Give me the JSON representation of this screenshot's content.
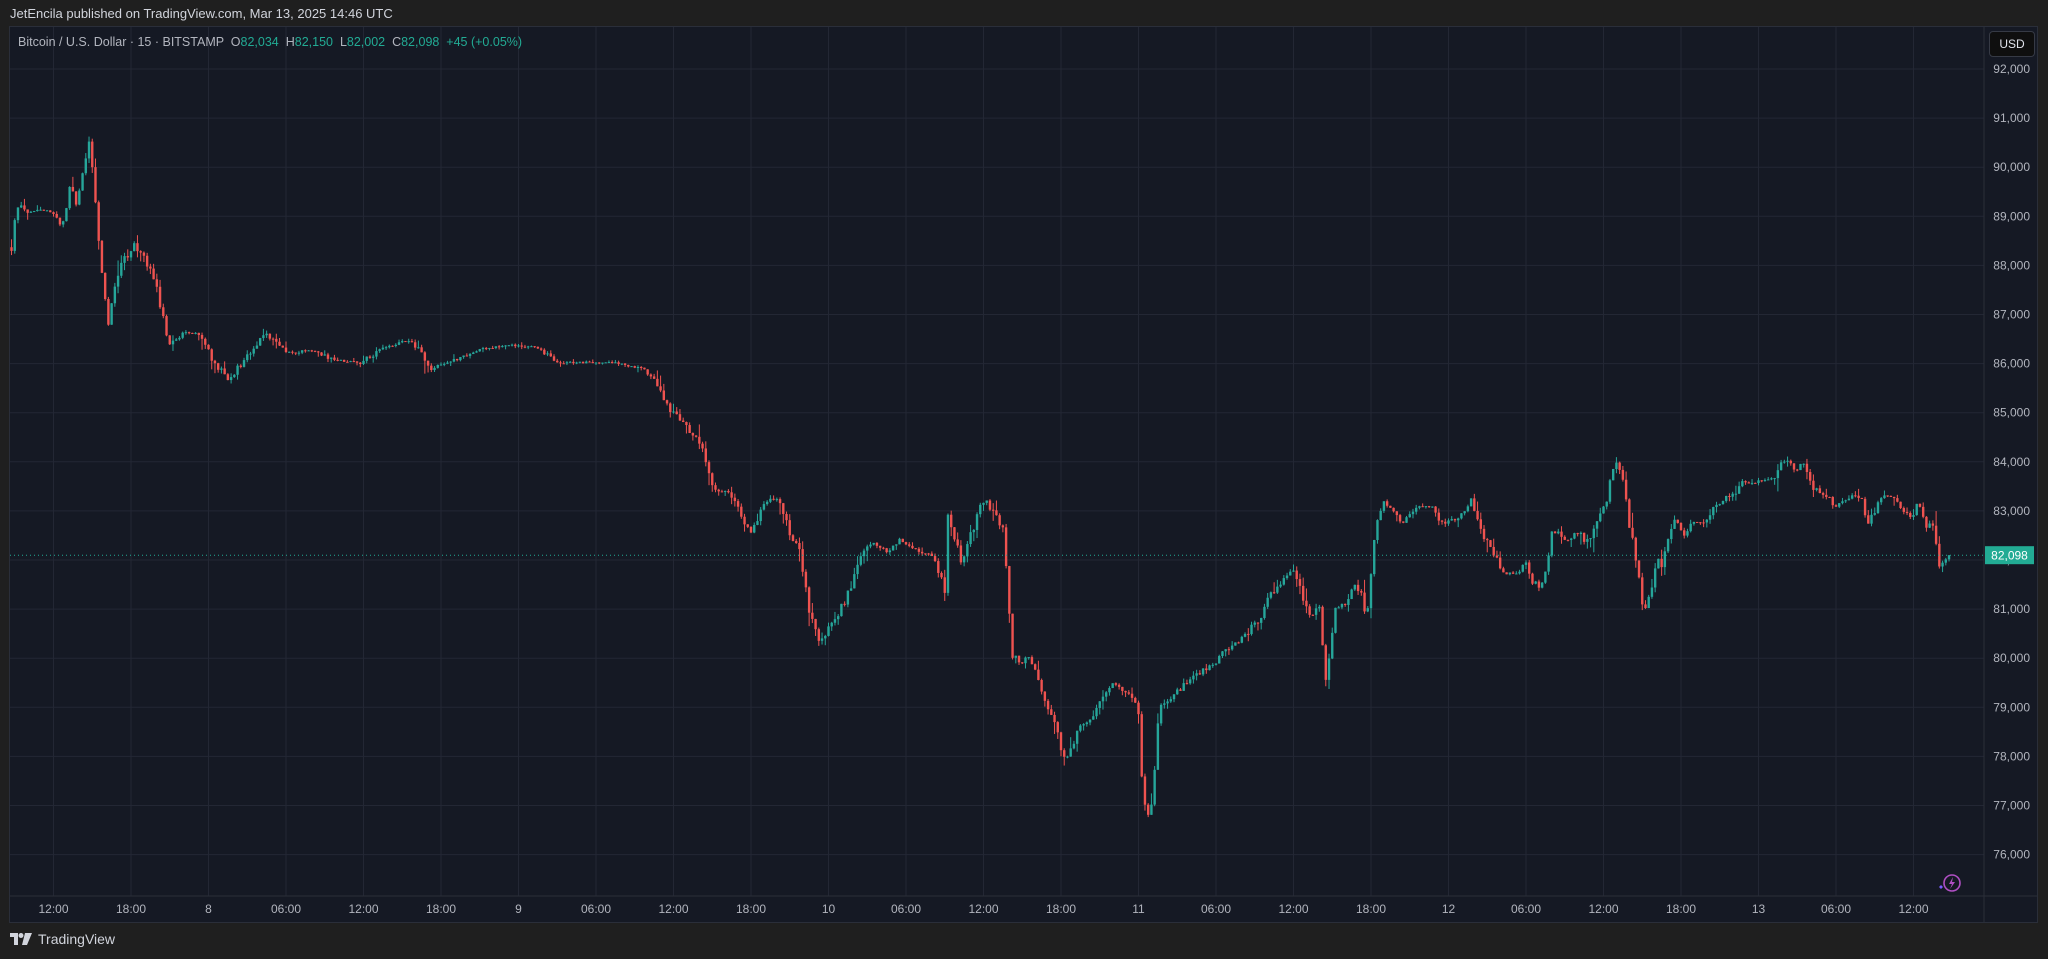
{
  "header": {
    "published": "JetEncila published on TradingView.com, Mar 13, 2025 14:46 UTC"
  },
  "legend": {
    "symbol": "Bitcoin / U.S. Dollar · 15 · BITSTAMP",
    "open_label": "O",
    "open": "82,034",
    "high_label": "H",
    "high": "82,150",
    "low_label": "L",
    "low": "82,002",
    "close_label": "C",
    "close": "82,098",
    "change": "+45 (+0.05%)"
  },
  "currency_button": "USD",
  "footer": {
    "brand": "TradingView"
  },
  "colors": {
    "up": "#26a69a",
    "down": "#ef5350",
    "background": "#151924",
    "grid": "#232734",
    "last_price": "#22ab94"
  },
  "icons": {
    "footer_logo": "tradingview-logo-icon",
    "assistant": "lightning-icon"
  },
  "chart_data": {
    "type": "candlestick",
    "title": "Bitcoin / U.S. Dollar · 15 · BITSTAMP",
    "interval_minutes": 15,
    "x_unit": "hours since Mar 7 12:00",
    "x_range": [
      -3.25,
      146.75
    ],
    "ylim": [
      75300,
      92800
    ],
    "y_ticks": [
      76000,
      77000,
      78000,
      79000,
      80000,
      81000,
      82000,
      83000,
      84000,
      85000,
      86000,
      87000,
      88000,
      89000,
      90000,
      91000,
      92000
    ],
    "y_tick_labels": [
      "76,000",
      "77,000",
      "78,000",
      "79,000",
      "80,000",
      "81,000",
      "82,000",
      "83,000",
      "84,000",
      "85,000",
      "86,000",
      "87,000",
      "88,000",
      "89,000",
      "90,000",
      "91,000",
      "92,000"
    ],
    "x_ticks": [
      0,
      6,
      12,
      18,
      24,
      30,
      36,
      42,
      48,
      54,
      60,
      66,
      72,
      78,
      84,
      90,
      96,
      102,
      108,
      114,
      120,
      126,
      132,
      138,
      144
    ],
    "x_tick_labels": [
      "12:00",
      "18:00",
      "8",
      "06:00",
      "12:00",
      "18:00",
      "9",
      "06:00",
      "12:00",
      "18:00",
      "10",
      "06:00",
      "12:00",
      "18:00",
      "11",
      "06:00",
      "12:00",
      "18:00",
      "12",
      "06:00",
      "12:00",
      "18:00",
      "13",
      "06:00",
      "12:00"
    ],
    "last_price": 82098,
    "last_price_label": "82,098",
    "grid": true,
    "price_path": [
      [
        -3.3,
        88270
      ],
      [
        -2.8,
        89270
      ],
      [
        -1.8,
        89070
      ],
      [
        -1,
        89130
      ],
      [
        0.1,
        89070
      ],
      [
        0.66,
        88660
      ],
      [
        1.3,
        89740
      ],
      [
        1.8,
        89190
      ],
      [
        2.4,
        90100
      ],
      [
        2.7,
        90600
      ],
      [
        3.2,
        89470
      ],
      [
        3.6,
        88250
      ],
      [
        4.2,
        86750
      ],
      [
        5.1,
        87970
      ],
      [
        6.3,
        88450
      ],
      [
        7.9,
        87700
      ],
      [
        8.9,
        86340
      ],
      [
        10,
        86620
      ],
      [
        11.3,
        86620
      ],
      [
        12.5,
        86010
      ],
      [
        13.5,
        85670
      ],
      [
        14.8,
        86070
      ],
      [
        16.4,
        86620
      ],
      [
        18.3,
        86210
      ],
      [
        19.9,
        86280
      ],
      [
        21.8,
        86070
      ],
      [
        23.7,
        86010
      ],
      [
        25.7,
        86340
      ],
      [
        27.6,
        86480
      ],
      [
        28.4,
        86280
      ],
      [
        29.1,
        85870
      ],
      [
        31.5,
        86130
      ],
      [
        33,
        86280
      ],
      [
        35.3,
        86380
      ],
      [
        37.3,
        86340
      ],
      [
        39.2,
        86010
      ],
      [
        41.5,
        86030
      ],
      [
        43.9,
        86010
      ],
      [
        45.4,
        85910
      ],
      [
        46.5,
        85670
      ],
      [
        47.7,
        85050
      ],
      [
        48.5,
        84850
      ],
      [
        50,
        84440
      ],
      [
        50.8,
        83630
      ],
      [
        51.6,
        83370
      ],
      [
        52.3,
        83430
      ],
      [
        53.1,
        82960
      ],
      [
        54,
        82550
      ],
      [
        55,
        83160
      ],
      [
        56.1,
        83290
      ],
      [
        57,
        82550
      ],
      [
        57.8,
        82200
      ],
      [
        58.5,
        80980
      ],
      [
        59.2,
        80310
      ],
      [
        60.1,
        80630
      ],
      [
        61.3,
        81180
      ],
      [
        62.4,
        81940
      ],
      [
        63.2,
        82350
      ],
      [
        64.7,
        82140
      ],
      [
        65.5,
        82410
      ],
      [
        67,
        82200
      ],
      [
        68.2,
        82060
      ],
      [
        69,
        81390
      ],
      [
        69.2,
        83000
      ],
      [
        69.8,
        82410
      ],
      [
        70.3,
        81940
      ],
      [
        70.9,
        82410
      ],
      [
        72.1,
        83290
      ],
      [
        72.9,
        82880
      ],
      [
        73.5,
        82670
      ],
      [
        73.9,
        81450
      ],
      [
        74.2,
        80110
      ],
      [
        74.8,
        79900
      ],
      [
        75.6,
        80030
      ],
      [
        76.7,
        79090
      ],
      [
        77.5,
        78680
      ],
      [
        78.3,
        77870
      ],
      [
        78.8,
        78130
      ],
      [
        79.4,
        78600
      ],
      [
        80.6,
        78880
      ],
      [
        81.4,
        79350
      ],
      [
        82.2,
        79490
      ],
      [
        82.9,
        79350
      ],
      [
        83.7,
        79210
      ],
      [
        84.1,
        78680
      ],
      [
        84.3,
        77250
      ],
      [
        84.7,
        76770
      ],
      [
        85.1,
        77170
      ],
      [
        85.5,
        78680
      ],
      [
        85.8,
        79010
      ],
      [
        86.6,
        79210
      ],
      [
        87.6,
        79490
      ],
      [
        88.7,
        79700
      ],
      [
        89.9,
        79900
      ],
      [
        91,
        80230
      ],
      [
        92.2,
        80430
      ],
      [
        93.4,
        80840
      ],
      [
        94.5,
        81390
      ],
      [
        95.3,
        81590
      ],
      [
        96,
        81800
      ],
      [
        96.5,
        81450
      ],
      [
        97.2,
        80840
      ],
      [
        98,
        81120
      ],
      [
        98.4,
        79760
      ],
      [
        98.6,
        79410
      ],
      [
        98.9,
        80430
      ],
      [
        99.2,
        80980
      ],
      [
        100.1,
        81120
      ],
      [
        100.6,
        81530
      ],
      [
        101.3,
        81250
      ],
      [
        101.7,
        80840
      ],
      [
        101.9,
        81330
      ],
      [
        102.2,
        82410
      ],
      [
        102.5,
        82880
      ],
      [
        102.9,
        83220
      ],
      [
        103.4,
        83080
      ],
      [
        104.4,
        82750
      ],
      [
        105.4,
        83080
      ],
      [
        106.8,
        83080
      ],
      [
        107.5,
        82750
      ],
      [
        108.4,
        82810
      ],
      [
        109.3,
        83020
      ],
      [
        109.8,
        83290
      ],
      [
        110.3,
        82670
      ],
      [
        111,
        82350
      ],
      [
        111.6,
        82060
      ],
      [
        112.3,
        81730
      ],
      [
        113.4,
        81730
      ],
      [
        114.1,
        81940
      ],
      [
        114.4,
        81590
      ],
      [
        115.1,
        81450
      ],
      [
        115.6,
        81940
      ],
      [
        116,
        82610
      ],
      [
        116.5,
        82550
      ],
      [
        117.2,
        82410
      ],
      [
        117.9,
        82610
      ],
      [
        118.6,
        82350
      ],
      [
        119.3,
        82670
      ],
      [
        119.8,
        82960
      ],
      [
        120.3,
        83290
      ],
      [
        120.6,
        83830
      ],
      [
        121,
        84040
      ],
      [
        121.3,
        83690
      ],
      [
        121.7,
        83430
      ],
      [
        121.9,
        82610
      ],
      [
        122.2,
        82470
      ],
      [
        122.5,
        82060
      ],
      [
        122.8,
        81530
      ],
      [
        123.1,
        80920
      ],
      [
        123.4,
        81050
      ],
      [
        123.8,
        81590
      ],
      [
        124.1,
        82060
      ],
      [
        124.5,
        81940
      ],
      [
        124.9,
        82410
      ],
      [
        125.5,
        82810
      ],
      [
        126.2,
        82470
      ],
      [
        126.9,
        82750
      ],
      [
        127.6,
        82750
      ],
      [
        128.3,
        82960
      ],
      [
        129.1,
        83220
      ],
      [
        130.1,
        83360
      ],
      [
        130.7,
        83570
      ],
      [
        131.4,
        83570
      ],
      [
        132.1,
        83630
      ],
      [
        132.8,
        83630
      ],
      [
        133.3,
        83670
      ],
      [
        134,
        84040
      ],
      [
        134.5,
        83970
      ],
      [
        135,
        83830
      ],
      [
        135.5,
        83970
      ],
      [
        135.9,
        83630
      ],
      [
        136.6,
        83360
      ],
      [
        137.3,
        83290
      ],
      [
        138,
        83080
      ],
      [
        138.7,
        83220
      ],
      [
        139.4,
        83360
      ],
      [
        140.1,
        83160
      ],
      [
        140.5,
        82750
      ],
      [
        141.1,
        83020
      ],
      [
        141.8,
        83360
      ],
      [
        142.5,
        83220
      ],
      [
        143.2,
        82960
      ],
      [
        143.9,
        82880
      ],
      [
        144.3,
        83160
      ],
      [
        144.7,
        82880
      ],
      [
        145,
        82610
      ],
      [
        145.4,
        82810
      ],
      [
        145.7,
        82410
      ],
      [
        145.9,
        81800
      ],
      [
        146.2,
        81940
      ],
      [
        146.5,
        82040
      ],
      [
        146.75,
        82098
      ]
    ]
  }
}
